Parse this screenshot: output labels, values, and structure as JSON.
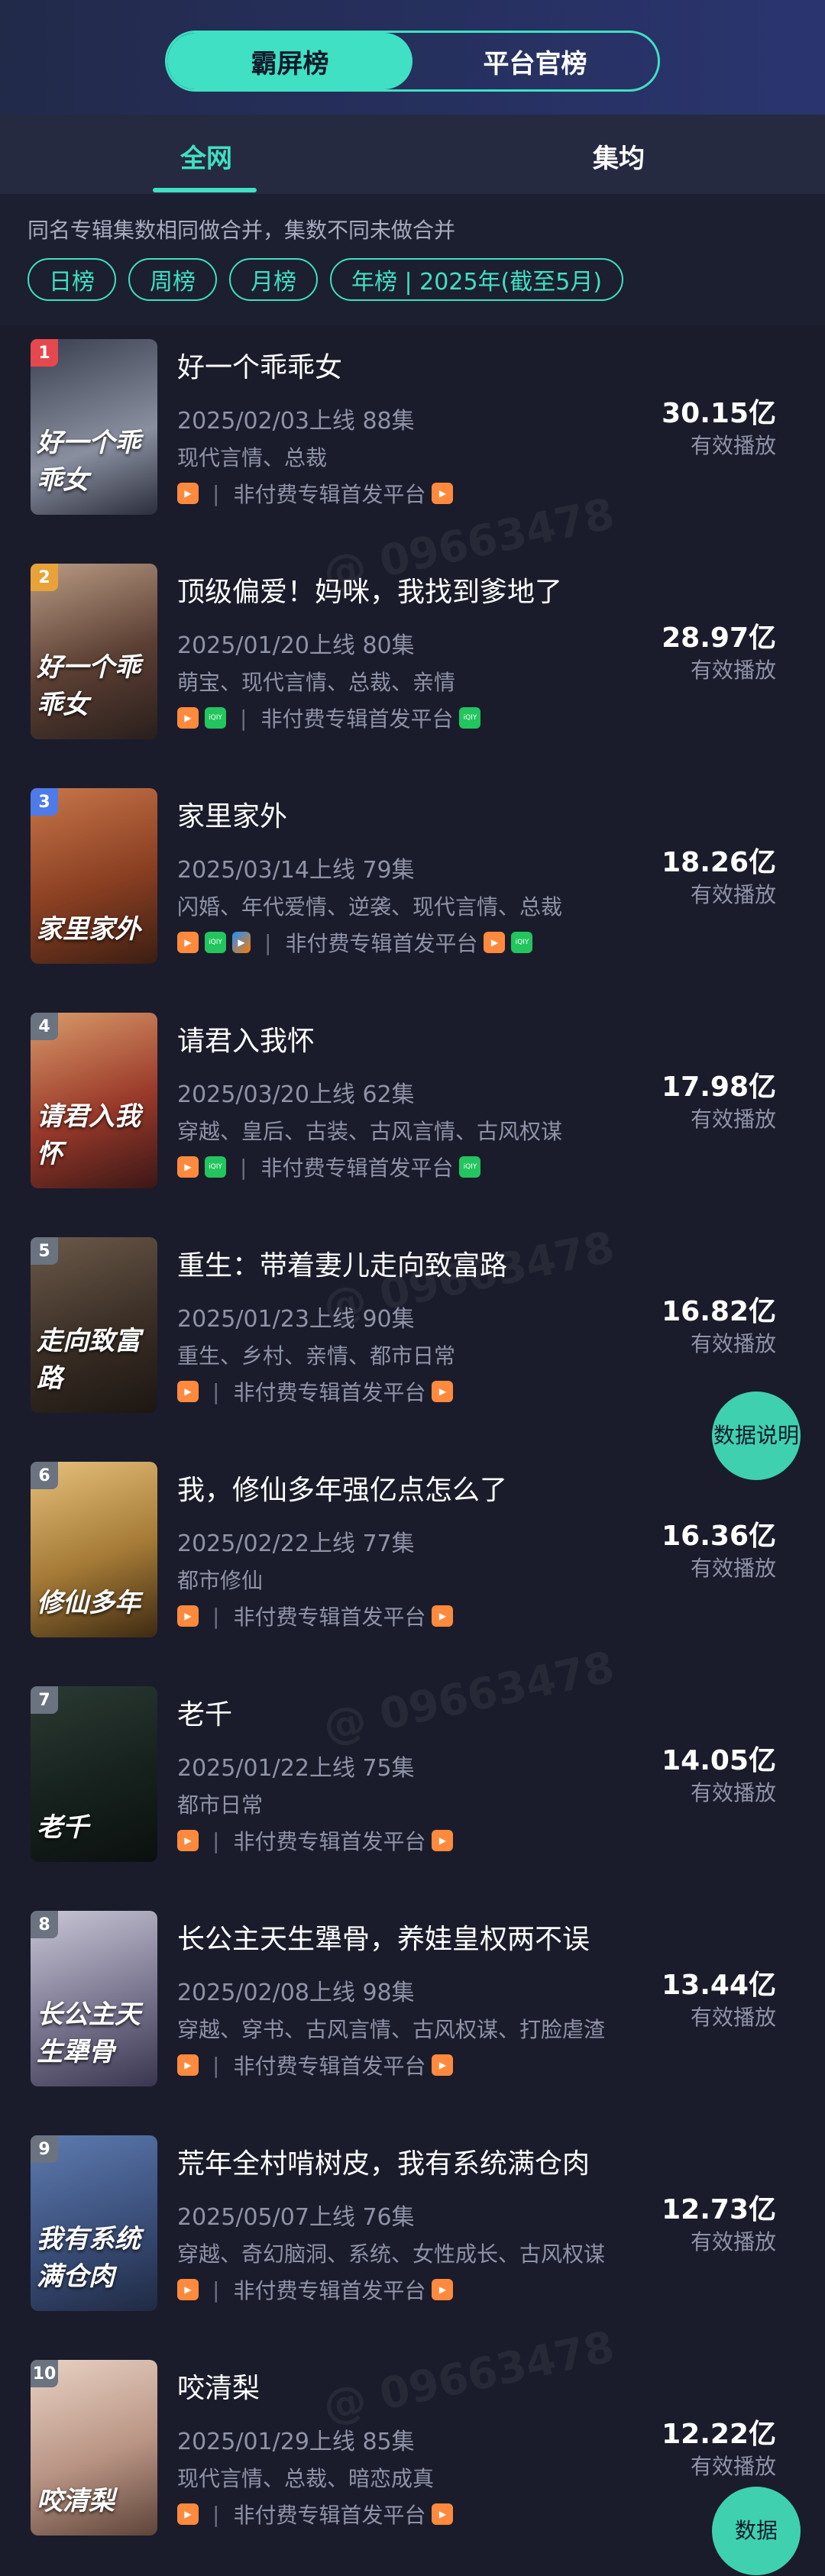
{
  "segment": {
    "active": "霸屏榜",
    "inactive": "平台官榜"
  },
  "tabs": {
    "all": "全网",
    "avg": "集均"
  },
  "note": "同名专辑集数相同做合并，集数不同未做合并",
  "chips": [
    "日榜",
    "周榜",
    "月榜",
    "年榜 | 2025年(截至5月)"
  ],
  "value_label": "有效播放",
  "platform_label": "非付费专辑首发平台",
  "fab_label": "数据说明",
  "fab_label2": "数据",
  "watermark": "@ 09663478",
  "colors": {
    "accent": "#3fe0c3",
    "rank1": "#e5484d",
    "rank2": "#e8a23a",
    "rank3": "#4f7be8",
    "rank_other": "#6b7280"
  },
  "items": [
    {
      "rank": "1",
      "title": "好一个乖乖女",
      "meta": "2025/02/03上线 88集",
      "tags": "现代言情、总裁",
      "value": "30.15亿",
      "pre": [
        "orange"
      ],
      "post": [
        "orange"
      ],
      "poster_text": "好一个乖乖女",
      "poster_bg": "linear-gradient(160deg,#3a3f4f,#8a8fa0 60%,#2b2f3c)"
    },
    {
      "rank": "2",
      "title": "顶级偏爱！妈咪，我找到爹地了",
      "meta": "2025/01/20上线 80集",
      "tags": "萌宝、现代言情、总裁、亲情",
      "value": "28.97亿",
      "pre": [
        "orange",
        "green"
      ],
      "post": [
        "green"
      ],
      "poster_text": "好一个乖乖女",
      "poster_bg": "linear-gradient(160deg,#b99b84,#5b3f33 55%,#2a1f1c)"
    },
    {
      "rank": "3",
      "title": "家里家外",
      "meta": "2025/03/14上线 79集",
      "tags": "闪婚、年代爱情、逆袭、现代言情、总裁",
      "value": "18.26亿",
      "pre": [
        "orange",
        "green",
        "blue"
      ],
      "post": [
        "orange",
        "green"
      ],
      "poster_text": "家里家外",
      "poster_bg": "linear-gradient(160deg,#c8764a,#8a3f22 55%,#3b1e12)"
    },
    {
      "rank": "4",
      "title": "请君入我怀",
      "meta": "2025/03/20上线 62集",
      "tags": "穿越、皇后、古装、古风言情、古风权谋",
      "value": "17.98亿",
      "pre": [
        "orange",
        "green"
      ],
      "post": [
        "green"
      ],
      "poster_text": "请君入我怀",
      "poster_bg": "linear-gradient(160deg,#d99a6a,#9a3a2a 55%,#3c1716)"
    },
    {
      "rank": "5",
      "title": "重生：带着妻儿走向致富路",
      "meta": "2025/01/23上线 90集",
      "tags": "重生、乡村、亲情、都市日常",
      "value": "16.82亿",
      "pre": [
        "orange"
      ],
      "post": [
        "orange"
      ],
      "poster_text": "走向致富路",
      "poster_bg": "linear-gradient(160deg,#6b5a4a,#3a2e25 55%,#1c1612)"
    },
    {
      "rank": "6",
      "title": "我，修仙多年强亿点怎么了",
      "meta": "2025/02/22上线 77集",
      "tags": "都市修仙",
      "value": "16.36亿",
      "pre": [
        "orange"
      ],
      "post": [
        "orange"
      ],
      "poster_text": "修仙多年",
      "poster_bg": "linear-gradient(160deg,#e6c07a,#a47a36 55%,#3e2a12)"
    },
    {
      "rank": "7",
      "title": "老千",
      "meta": "2025/01/22上线 75集",
      "tags": "都市日常",
      "value": "14.05亿",
      "pre": [
        "orange"
      ],
      "post": [
        "orange"
      ],
      "poster_text": "老千",
      "poster_bg": "linear-gradient(160deg,#2b3a33,#16211d 55%,#0b100e)"
    },
    {
      "rank": "8",
      "title": "长公主天生犟骨，养娃皇权两不误",
      "meta": "2025/02/08上线 98集",
      "tags": "穿越、穿书、古风言情、古风权谋、打脸虐渣",
      "value": "13.44亿",
      "pre": [
        "orange"
      ],
      "post": [
        "orange"
      ],
      "poster_text": "长公主天生犟骨",
      "poster_bg": "linear-gradient(160deg,#c9c6d6,#7b7690 55%,#3a3650)"
    },
    {
      "rank": "9",
      "title": "荒年全村啃树皮，我有系统满仓肉",
      "meta": "2025/05/07上线 76集",
      "tags": "穿越、奇幻脑洞、系统、女性成长、古风权谋",
      "value": "12.73亿",
      "pre": [
        "orange"
      ],
      "post": [
        "orange"
      ],
      "poster_text": "我有系统满仓肉",
      "poster_bg": "linear-gradient(160deg,#5d7bb0,#3b4f7a 55%,#1f2a44)"
    },
    {
      "rank": "10",
      "title": "咬清梨",
      "meta": "2025/01/29上线 85集",
      "tags": "现代言情、总裁、暗恋成真",
      "value": "12.22亿",
      "pre": [
        "orange"
      ],
      "post": [
        "orange"
      ],
      "poster_text": "咬清梨",
      "poster_bg": "linear-gradient(160deg,#e8d2c4,#b99484 55%,#5e4439)"
    }
  ]
}
